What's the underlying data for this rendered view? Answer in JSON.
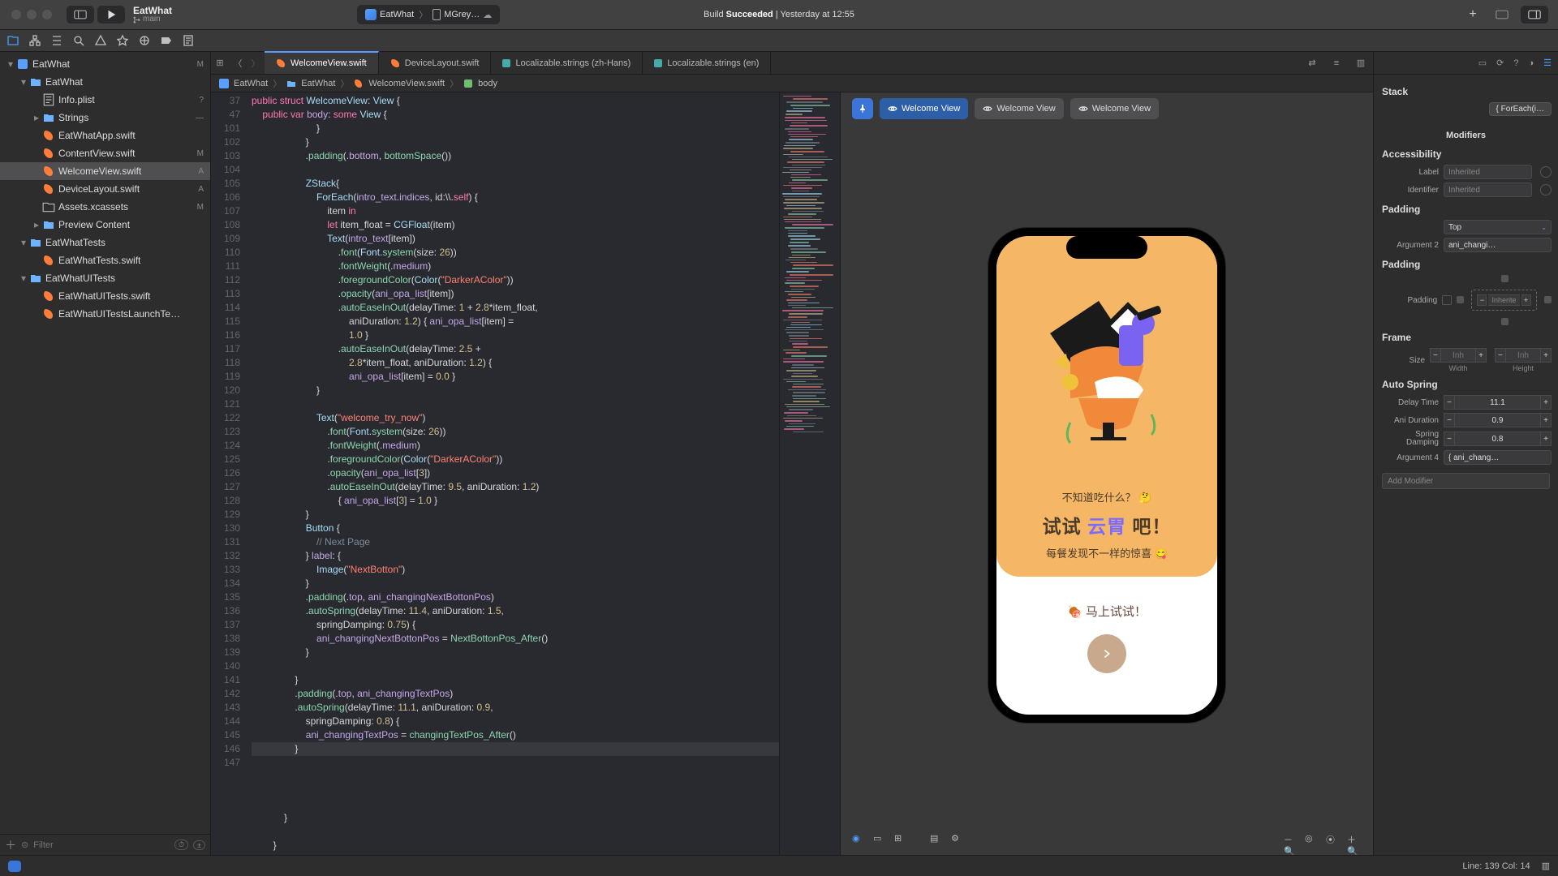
{
  "titlebar": {
    "project": "EatWhat",
    "branch": "main",
    "scheme_app": "EatWhat",
    "scheme_device": "MGrey…",
    "build_status_prefix": "Build ",
    "build_status_word": "Succeeded",
    "build_status_suffix": " | Yesterday at 12:55"
  },
  "navigator": {
    "items": [
      {
        "pad": 0,
        "kind": "proj",
        "disc": "▾",
        "label": "EatWhat",
        "badge": "M"
      },
      {
        "pad": 1,
        "kind": "folder",
        "disc": "▾",
        "label": "EatWhat",
        "badge": ""
      },
      {
        "pad": 2,
        "kind": "plist",
        "disc": "",
        "label": "Info.plist",
        "badge": "?"
      },
      {
        "pad": 2,
        "kind": "folder",
        "disc": "▸",
        "label": "Strings",
        "badge": "—"
      },
      {
        "pad": 2,
        "kind": "swift",
        "disc": "",
        "label": "EatWhatApp.swift",
        "badge": ""
      },
      {
        "pad": 2,
        "kind": "swift",
        "disc": "",
        "label": "ContentView.swift",
        "badge": "M"
      },
      {
        "pad": 2,
        "kind": "swift",
        "disc": "",
        "label": "WelcomeView.swift",
        "badge": "A",
        "selected": true
      },
      {
        "pad": 2,
        "kind": "swift",
        "disc": "",
        "label": "DeviceLayout.swift",
        "badge": "A"
      },
      {
        "pad": 2,
        "kind": "assets",
        "disc": "",
        "label": "Assets.xcassets",
        "badge": "M"
      },
      {
        "pad": 2,
        "kind": "folder",
        "disc": "▸",
        "label": "Preview Content",
        "badge": ""
      },
      {
        "pad": 1,
        "kind": "folder",
        "disc": "▾",
        "label": "EatWhatTests",
        "badge": ""
      },
      {
        "pad": 2,
        "kind": "swift",
        "disc": "",
        "label": "EatWhatTests.swift",
        "badge": ""
      },
      {
        "pad": 1,
        "kind": "folder",
        "disc": "▾",
        "label": "EatWhatUITests",
        "badge": ""
      },
      {
        "pad": 2,
        "kind": "swift",
        "disc": "",
        "label": "EatWhatUITests.swift",
        "badge": ""
      },
      {
        "pad": 2,
        "kind": "swift",
        "disc": "",
        "label": "EatWhatUITestsLaunchTe…",
        "badge": ""
      }
    ],
    "filter_placeholder": "Filter"
  },
  "tabs": [
    {
      "label": "WelcomeView.swift",
      "kind": "swift",
      "active": true
    },
    {
      "label": "DeviceLayout.swift",
      "kind": "swift"
    },
    {
      "label": "Localizable.strings (zh-Hans)",
      "kind": "strings"
    },
    {
      "label": "Localizable.strings (en)",
      "kind": "strings"
    }
  ],
  "jumpbar": {
    "seg1": "EatWhat",
    "seg2": "EatWhat",
    "seg3": "WelcomeView.swift",
    "seg4": "body"
  },
  "code": {
    "lines": [
      {
        "n": 37,
        "html": "<span class='k'>public</span> <span class='k'>struct</span> <span class='t'>WelcomeView</span>: <span class='t'>View</span> {"
      },
      {
        "n": 47,
        "html": "    <span class='k'>public</span> <span class='k'>var</span> <span class='m'>body</span>: <span class='k'>some</span> <span class='t'>View</span> {"
      },
      {
        "n": 101,
        "html": "                        }"
      },
      {
        "n": 102,
        "html": "                    }"
      },
      {
        "n": 103,
        "html": "                    .<span class='f'>padding</span>(.<span class='m'>bottom</span>, <span class='f'>bottomSpace</span>())"
      },
      {
        "n": 104,
        "html": ""
      },
      {
        "n": 105,
        "html": "                    <span class='t'>ZStack</span>{"
      },
      {
        "n": 106,
        "html": "                        <span class='t'>ForEach</span>(<span class='m'>intro_text</span>.<span class='m'>indices</span>, id:\\\\.<span class='k'>self</span>) {"
      },
      {
        "n": 107,
        "html": "                            item <span class='k'>in</span>"
      },
      {
        "n": 108,
        "html": "                            <span class='k'>let</span> item_float = <span class='t'>CGFloat</span>(item)"
      },
      {
        "n": 109,
        "html": "                            <span class='t'>Text</span>(<span class='m'>intro_text</span>[item])"
      },
      {
        "n": 110,
        "html": "                                .<span class='f'>font</span>(<span class='t'>Font</span>.<span class='f'>system</span>(size: <span class='n'>26</span>))"
      },
      {
        "n": 111,
        "html": "                                .<span class='f'>fontWeight</span>(.<span class='m'>medium</span>)"
      },
      {
        "n": 112,
        "html": "                                .<span class='f'>foregroundColor</span>(<span class='t'>Color</span>(<span class='s'>\"DarkerAColor\"</span>))"
      },
      {
        "n": 113,
        "html": "                                .<span class='f'>opacity</span>(<span class='m'>ani_opa_list</span>[item])"
      },
      {
        "n": 114,
        "html": "                                .<span class='f'>autoEaseInOut</span>(delayTime: <span class='n'>1</span> + <span class='n'>2.8</span>*item_float,\\n                                    aniDuration: <span class='n'>1.2</span>) { <span class='m'>ani_opa_list</span>[item] =\\n                                    <span class='n'>1.0</span> }"
      },
      {
        "n": 115,
        "html": "                                .<span class='f'>autoEaseInOut</span>(delayTime: <span class='n'>2.5</span> +\\n                                    <span class='n'>2.8</span>*item_float, aniDuration: <span class='n'>1.2</span>) {\\n                                    <span class='m'>ani_opa_list</span>[item] = <span class='n'>0.0</span> }"
      },
      {
        "n": 116,
        "html": "                        }"
      },
      {
        "n": 117,
        "html": ""
      },
      {
        "n": 118,
        "html": "                        <span class='t'>Text</span>(<span class='s'>\"welcome_try_now\"</span>)"
      },
      {
        "n": 119,
        "html": "                            .<span class='f'>font</span>(<span class='t'>Font</span>.<span class='f'>system</span>(size: <span class='n'>26</span>))"
      },
      {
        "n": 120,
        "html": "                            .<span class='f'>fontWeight</span>(.<span class='m'>medium</span>)"
      },
      {
        "n": 121,
        "html": "                            .<span class='f'>foregroundColor</span>(<span class='t'>Color</span>(<span class='s'>\"DarkerAColor\"</span>))"
      },
      {
        "n": 122,
        "html": "                            .<span class='f'>opacity</span>(<span class='m'>ani_opa_list</span>[<span class='n'>3</span>])"
      },
      {
        "n": 123,
        "html": "                            .<span class='f'>autoEaseInOut</span>(delayTime: <span class='n'>9.5</span>, aniDuration: <span class='n'>1.2</span>)\\n                                { <span class='m'>ani_opa_list</span>[<span class='n'>3</span>] = <span class='n'>1.0</span> }"
      },
      {
        "n": 124,
        "html": "                    }"
      },
      {
        "n": 125,
        "html": "                    <span class='t'>Button</span> {"
      },
      {
        "n": 126,
        "html": "                        <span class='c'>// Next Page</span>"
      },
      {
        "n": 127,
        "html": "                    } <span class='m'>label</span>: {"
      },
      {
        "n": 128,
        "html": "                        <span class='t'>Image</span>(<span class='s'>\"NextBotton\"</span>)"
      },
      {
        "n": 129,
        "html": "                    }"
      },
      {
        "n": 130,
        "html": "                    .<span class='f'>padding</span>(.<span class='m'>top</span>, <span class='m'>ani_changingNextBottonPos</span>)"
      },
      {
        "n": 131,
        "html": "                    .<span class='f'>autoSpring</span>(delayTime: <span class='n'>11.4</span>, aniDuration: <span class='n'>1.5</span>,\\n                        springDamping: <span class='n'>0.75</span>) {"
      },
      {
        "n": 132,
        "html": "                        <span class='m'>ani_changingNextBottonPos</span> = <span class='f'>NextBottonPos_After</span>()"
      },
      {
        "n": 133,
        "html": "                    }"
      },
      {
        "n": 134,
        "html": ""
      },
      {
        "n": 135,
        "html": "                }"
      },
      {
        "n": 136,
        "html": "                .<span class='f'>padding</span>(.<span class='m'>top</span>, <span class='m'>ani_changingTextPos</span>)"
      },
      {
        "n": 137,
        "html": "                .<span class='f'>autoSpring</span>(delayTime: <span class='n'>11.1</span>, aniDuration: <span class='n'>0.9</span>,\\n                    springDamping: <span class='n'>0.8</span>) {"
      },
      {
        "n": 138,
        "html": "                    <span class='m'>ani_changingTextPos</span> = <span class='f'>changingTextPos_After</span>()"
      },
      {
        "n": 139,
        "html": "                }",
        "hl": true
      },
      {
        "n": 140,
        "html": ""
      },
      {
        "n": 141,
        "html": ""
      },
      {
        "n": 142,
        "html": ""
      },
      {
        "n": 143,
        "html": ""
      },
      {
        "n": 144,
        "html": "            }"
      },
      {
        "n": 145,
        "html": ""
      },
      {
        "n": 146,
        "html": "        }"
      },
      {
        "n": 147,
        "html": "    }"
      }
    ]
  },
  "canvas": {
    "chips": [
      "Welcome View",
      "Welcome View",
      "Welcome View"
    ],
    "hero_line1": "不知道吃什么？ 🤔",
    "hero_line2_a": "试试 ",
    "hero_line2_b": "云胃",
    "hero_line2_c": " 吧！",
    "hero_line3": "每餐发现不一样的惊喜 😋",
    "cta": "🍖 马上试试！"
  },
  "inspector": {
    "stack_label": "Stack",
    "stack_value": "{ ForEach(i…",
    "modifiers_label": "Modifiers",
    "accessibility_label": "Accessibility",
    "acc_label": "Label",
    "acc_identifier": "Identifier",
    "inherited": "Inherited",
    "padding_label": "Padding",
    "padding_edge": "Top",
    "padding_arg2": "Argument 2",
    "padding_arg2_val": "ani_changi…",
    "padding_row_label": "Padding",
    "inherit": "Inherite",
    "frame_label": "Frame",
    "size_label": "Size",
    "inh": "Inh",
    "width": "Width",
    "height": "Height",
    "autospring_label": "Auto Spring",
    "delay_time": "Delay Time",
    "delay_time_val": "11.1",
    "ani_duration": "Ani Duration",
    "ani_duration_val": "0.9",
    "spring_damping": "Spring\nDamping",
    "spring_damping_val": "0.8",
    "arg4": "Argument 4",
    "arg4_val": "{ ani_chang…",
    "add_modifier": "Add Modifier"
  },
  "statusbar": {
    "line_col": "Line: 139  Col: 14"
  }
}
